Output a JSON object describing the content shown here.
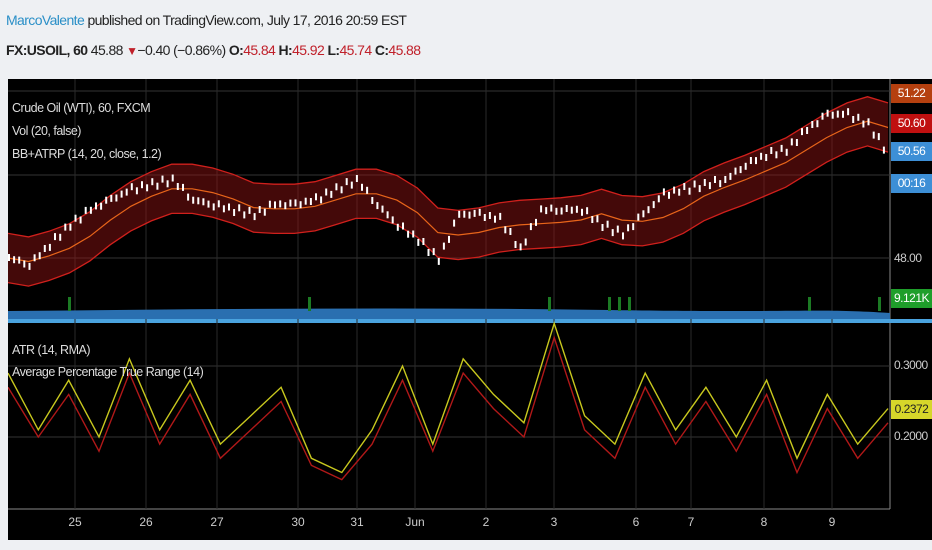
{
  "header": {
    "author": "MarcoValente",
    "published": "published on TradingView.com, July 17, 2016 20:59 EST",
    "symbol": "FX:USOIL, 60",
    "last": "45.88",
    "change": "−0.40 (−0.86%)",
    "o_label": "O:",
    "o": "45.84",
    "h_label": "H:",
    "h": "45.92",
    "l_label": "L:",
    "l": "45.74",
    "c_label": "C:",
    "c": "45.88",
    "down_arrow": "▼"
  },
  "legend": {
    "main": "Crude Oil (WTI), 60, FXCM",
    "vol": "Vol (20, false)",
    "bb": "BB+ATRP (14, 20, close, 1.2)",
    "atr": "ATR (14, RMA)",
    "atrp": "Average Percentage True Range (14)"
  },
  "price_axis": {
    "tags": [
      {
        "text": "51.22",
        "color": "#b5400f"
      },
      {
        "text": "50.60",
        "color": "#c01010"
      },
      {
        "text": "50.56",
        "color": "#3d8fd6"
      },
      {
        "text": "00:16",
        "color": "#3d8fd6"
      },
      {
        "text": "9.121K",
        "color": "#1e9e2a"
      },
      {
        "text": "0.2372",
        "color": "#d6d62a"
      }
    ],
    "labels": [
      "48.00",
      "0.3000",
      "0.2000"
    ]
  },
  "time_axis": [
    "25",
    "26",
    "27",
    "30",
    "31",
    "Jun",
    "2",
    "3",
    "6",
    "7",
    "8",
    "9"
  ],
  "colors": {
    "band": "#d0201c",
    "basis": "#e8651a",
    "atr": "#b01818",
    "atrp": "#c8c81e",
    "candle": "#ffffff",
    "volume": "#2a6fb0"
  },
  "chart_data": {
    "type": "line",
    "title": "Crude Oil (WTI), 60, FXCM",
    "price_series": {
      "name": "close",
      "ylim": [
        47.4,
        51.9
      ],
      "values": [
        48.0,
        47.83,
        48.32,
        48.8,
        49.17,
        49.41,
        49.66,
        49.78,
        49.9,
        49.41,
        49.29,
        49.17,
        49.05,
        49.29,
        49.29,
        49.41,
        49.66,
        49.9,
        49.29,
        48.8,
        48.44,
        47.95,
        49.05,
        49.05,
        48.93,
        48.2,
        49.17,
        49.17,
        49.17,
        48.8,
        48.56,
        49.05,
        49.54,
        49.66,
        49.78,
        49.9,
        50.27,
        50.51,
        50.63,
        51.12,
        51.49,
        51.49,
        51.24,
        50.51
      ]
    },
    "bb_width": 0.6,
    "atr_series": {
      "ylim": [
        0.12,
        0.38
      ],
      "atrp": [
        0.29,
        0.21,
        0.28,
        0.2,
        0.31,
        0.21,
        0.28,
        0.19,
        0.23,
        0.27,
        0.17,
        0.15,
        0.21,
        0.3,
        0.19,
        0.31,
        0.26,
        0.22,
        0.36,
        0.23,
        0.19,
        0.29,
        0.21,
        0.27,
        0.2,
        0.28,
        0.17,
        0.26,
        0.19,
        0.24
      ],
      "atr": [
        0.27,
        0.2,
        0.26,
        0.18,
        0.29,
        0.19,
        0.26,
        0.17,
        0.21,
        0.25,
        0.16,
        0.14,
        0.19,
        0.28,
        0.18,
        0.29,
        0.24,
        0.2,
        0.34,
        0.21,
        0.17,
        0.27,
        0.19,
        0.25,
        0.18,
        0.26,
        0.15,
        0.24,
        0.17,
        0.22
      ]
    }
  }
}
